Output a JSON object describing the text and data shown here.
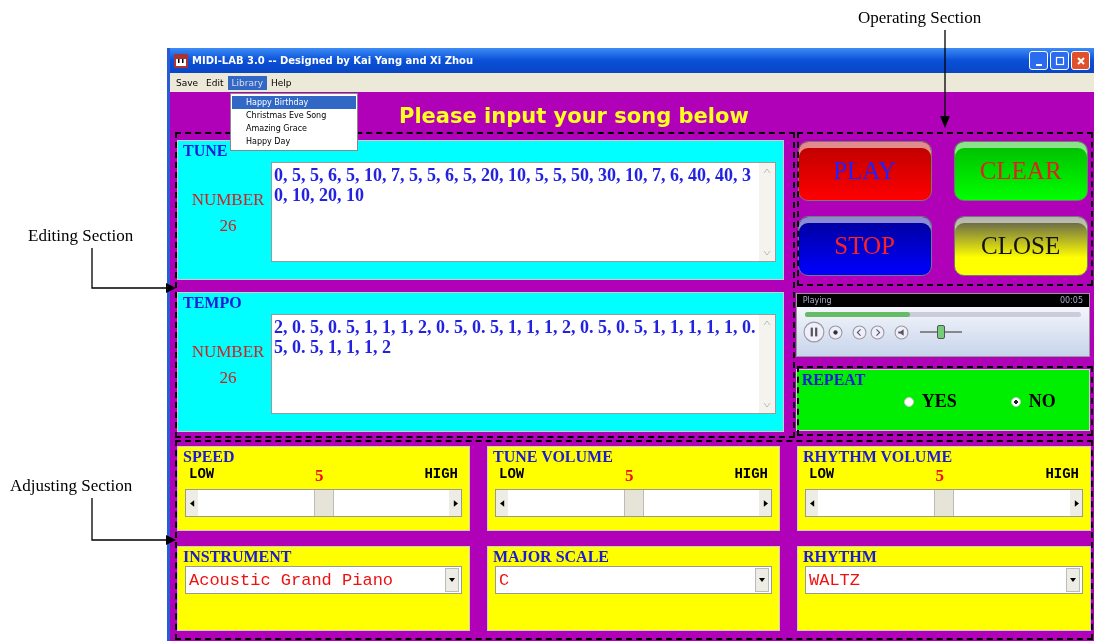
{
  "annotations": [
    {
      "kind": "editing",
      "text": "Editing Section"
    },
    {
      "kind": "adjusting",
      "text": "Adjusting Section"
    },
    {
      "kind": "operating",
      "text": "Operating Section"
    }
  ],
  "window": {
    "title": "MIDI-LAB 3.0  -- Designed by Kai Yang and Xi Zhou"
  },
  "menu": [
    {
      "label": "Save",
      "selected": false
    },
    {
      "label": "Edit",
      "selected": false
    },
    {
      "label": "Library",
      "selected": true
    },
    {
      "label": "Help",
      "selected": false
    }
  ],
  "library_menu": [
    {
      "label": "Happy Birthday",
      "selected": true
    },
    {
      "label": "Christmas Eve Song",
      "selected": false
    },
    {
      "label": "Amazing Grace",
      "selected": false
    },
    {
      "label": "Happy Day",
      "selected": false
    }
  ],
  "heading": "Please input your song below",
  "editors": [
    {
      "legend": "TUNE",
      "number_label": "NUMBER",
      "number": "26",
      "text": "0, 5, 5, 6, 5, 10, 7, 5, 5, 6, 5, 20, 10, 5, 5, 50, 30, 10, 7, 6, 40, 40, 30, 10, 20, 10"
    },
    {
      "legend": "TEMPO",
      "number_label": "NUMBER",
      "number": "26",
      "text": "2, 0. 5, 0. 5, 1, 1, 1, 2, 0. 5, 0. 5, 1, 1, 1, 2, 0. 5, 0. 5, 1, 1, 1, 1, 1, 0. 5, 0. 5, 1, 1, 1, 2"
    }
  ],
  "buttons": [
    {
      "label": "PLAY",
      "kind": "play"
    },
    {
      "label": "CLEAR",
      "kind": "clear"
    },
    {
      "label": "STOP",
      "kind": "stop"
    },
    {
      "label": "CLOSE",
      "kind": "close"
    }
  ],
  "player": {
    "status": "Playing",
    "time": "00:05",
    "level": 0.38,
    "volume": {
      "level": 0.5
    }
  },
  "repeat": {
    "legend": "REPEAT",
    "options": [
      {
        "label": "YES",
        "selected": false
      },
      {
        "label": "NO",
        "selected": true
      }
    ]
  },
  "sliders": [
    {
      "legend": "SPEED",
      "low": "LOW",
      "value": "5",
      "high": "HIGH",
      "level": 0.5
    },
    {
      "legend": "TUNE  VOLUME",
      "low": "LOW",
      "value": "5",
      "high": "HIGH",
      "level": 0.5
    },
    {
      "legend": "RHYTHM  VOLUME",
      "low": "LOW",
      "value": "5",
      "high": "HIGH",
      "level": 0.5
    }
  ],
  "selects": [
    {
      "legend": "INSTRUMENT",
      "value": "Acoustic Grand Piano"
    },
    {
      "legend": "MAJOR SCALE",
      "value": "C"
    },
    {
      "legend": "RHYTHM",
      "value": "WALTZ"
    }
  ]
}
